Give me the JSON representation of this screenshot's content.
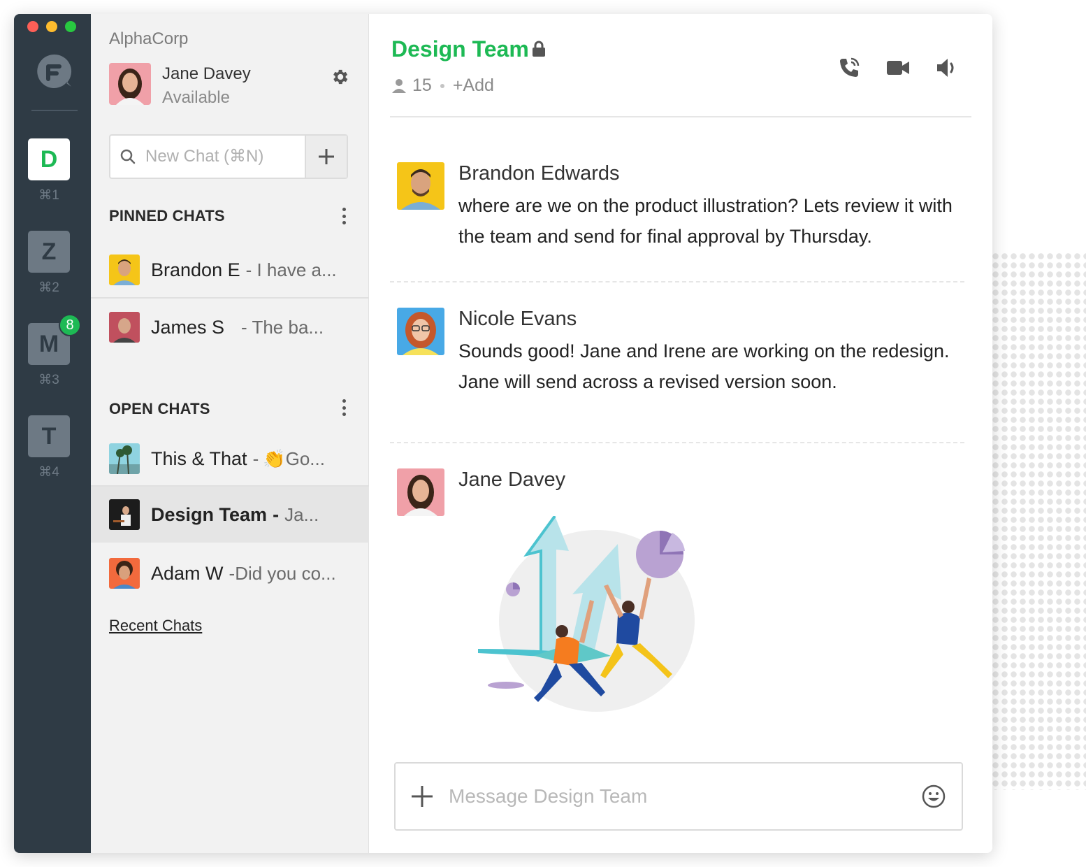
{
  "rail": {
    "workspaces": [
      {
        "letter": "D",
        "shortcut": "⌘1",
        "active": true
      },
      {
        "letter": "Z",
        "shortcut": "⌘2",
        "active": false
      },
      {
        "letter": "M",
        "shortcut": "⌘3",
        "active": false,
        "badge": "8"
      },
      {
        "letter": "T",
        "shortcut": "⌘4",
        "active": false
      }
    ]
  },
  "sidebar": {
    "org": "AlphaCorp",
    "user": {
      "name": "Jane Davey",
      "status": "Available"
    },
    "search": {
      "placeholder": "New Chat (⌘N)"
    },
    "pinned_title": "PINNED CHATS",
    "pinned": [
      {
        "name": "Brandon E",
        "preview": "- I have a..."
      },
      {
        "name": "James S",
        "preview": "- The ba..."
      }
    ],
    "open_title": "OPEN CHATS",
    "open": [
      {
        "name": "This & That",
        "dash": "-",
        "emoji": "👏",
        "preview": "Go..."
      },
      {
        "name": "Design Team",
        "dash": "-",
        "preview": "Ja...",
        "active": true
      },
      {
        "name": "Adam W",
        "preview": "-Did you co..."
      }
    ],
    "recent_link": "Recent Chats"
  },
  "channel": {
    "title": "Design Team",
    "member_count": "15",
    "add_label": "+Add"
  },
  "messages": [
    {
      "author": "Brandon Edwards",
      "text": "where are we on the product illustration? Lets review it with the team and send for final approval by Thursday."
    },
    {
      "author": "Nicole Evans",
      "text": "Sounds good! Jane and Irene are working on the redesign. Jane will send across a revised version soon."
    },
    {
      "author": "Jane Davey",
      "text": ""
    }
  ],
  "composer": {
    "placeholder": "Message Design Team"
  },
  "colors": {
    "accent": "#1db954",
    "rail": "#2f3b45",
    "sidebar": "#f2f2f2"
  },
  "icons": [
    "search-icon",
    "plus-icon",
    "gear-icon",
    "lock-icon",
    "person-icon",
    "phone-icon",
    "video-icon",
    "speaker-icon",
    "emoji-icon"
  ]
}
